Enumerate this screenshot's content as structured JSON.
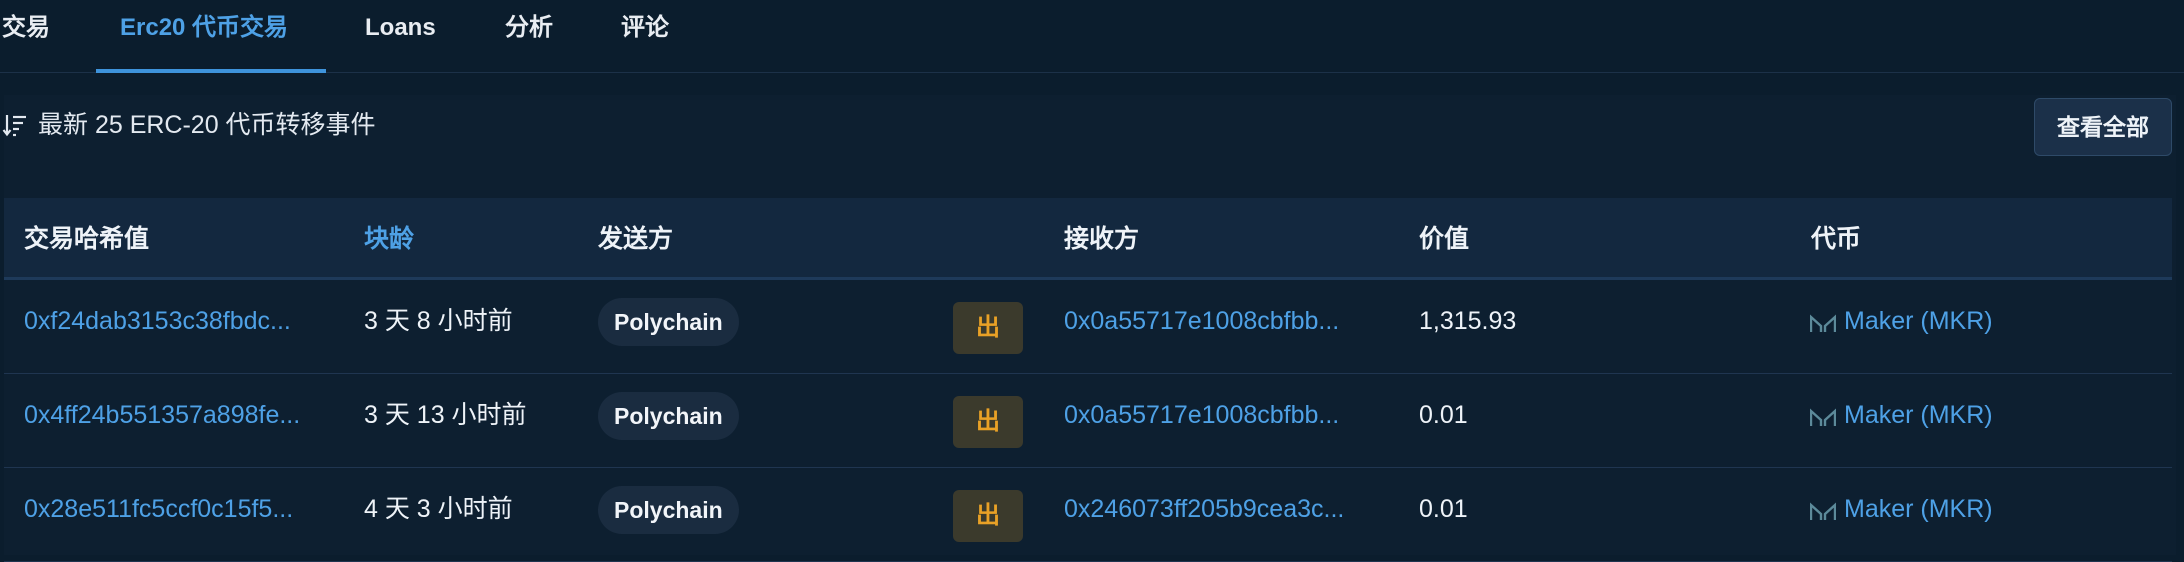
{
  "tabs": [
    {
      "label": "交易"
    },
    {
      "label": "Erc20 代币交易"
    },
    {
      "label": "Loans"
    },
    {
      "label": "分析"
    },
    {
      "label": "评论"
    }
  ],
  "panel": {
    "title": "最新 25 ERC-20 代币转移事件",
    "view_all_label": "查看全部"
  },
  "table": {
    "headers": {
      "tx_hash": "交易哈希值",
      "age": "块龄",
      "from": "发送方",
      "to": "接收方",
      "value": "价值",
      "token": "代币"
    },
    "rows": [
      {
        "tx_hash": "0xf24dab3153c38fbdc...",
        "age": "3 天 8 小时前",
        "from": "Polychain",
        "direction": "出",
        "to": "0x0a55717e1008cbfbb...",
        "value": "1,315.93",
        "token": "Maker (MKR)"
      },
      {
        "tx_hash": "0x4ff24b551357a898fe...",
        "age": "3 天 13 小时前",
        "from": "Polychain",
        "direction": "出",
        "to": "0x0a55717e1008cbfbb...",
        "value": "0.01",
        "token": "Maker (MKR)"
      },
      {
        "tx_hash": "0x28e511fc5ccf0c15f5...",
        "age": "4 天 3 小时前",
        "from": "Polychain",
        "direction": "出",
        "to": "0x246073ff205b9cea3c...",
        "value": "0.01",
        "token": "Maker (MKR)"
      }
    ]
  },
  "colors": {
    "accent": "#4ea1e6",
    "out_badge_text": "#e9a126",
    "maker_icon": "#5c8a9a"
  },
  "icons": {
    "sort": "sort-descending-icon",
    "token": "maker-logo-icon"
  }
}
